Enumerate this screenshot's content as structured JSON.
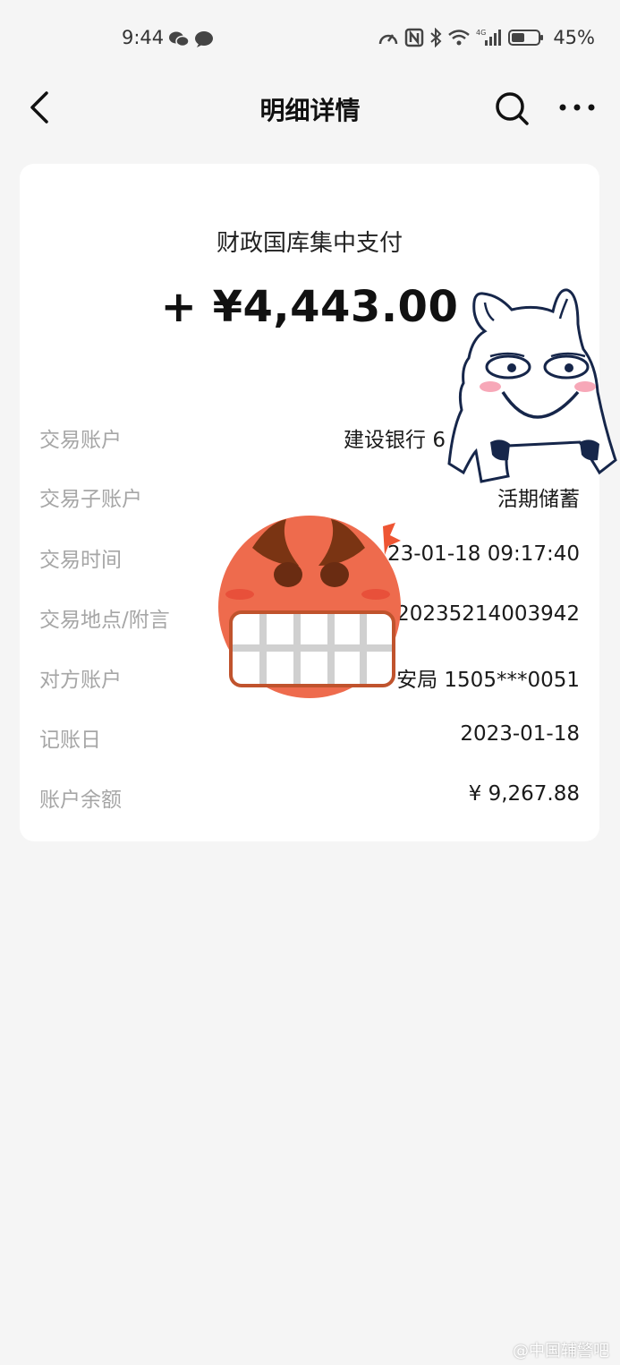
{
  "status_bar": {
    "time": "9:44",
    "battery": "45%",
    "network": "4G"
  },
  "nav": {
    "title": "明细详情"
  },
  "transaction": {
    "type": "财政国库集中支付",
    "amount": "+ ¥4,443.00",
    "rows": [
      {
        "label": "交易账户",
        "value": "建设银行 6"
      },
      {
        "label": "交易子账户",
        "value": "活期储蓄"
      },
      {
        "label": "交易时间",
        "value": "23-01-18 09:17:40"
      },
      {
        "label": "交易地点/附言",
        "value": "20235214003942"
      },
      {
        "label": "对方账户",
        "value": "安局 1505***0051"
      },
      {
        "label": "记账日",
        "value": "2023-01-18"
      },
      {
        "label": "账户余额",
        "value": "¥ 9,267.88"
      }
    ]
  },
  "watermark": "@中国辅警吧",
  "colors": {
    "background": "#f5f5f5",
    "card": "#ffffff",
    "label": "#a6a6a6",
    "emoji_face": "#ee6b4d"
  }
}
